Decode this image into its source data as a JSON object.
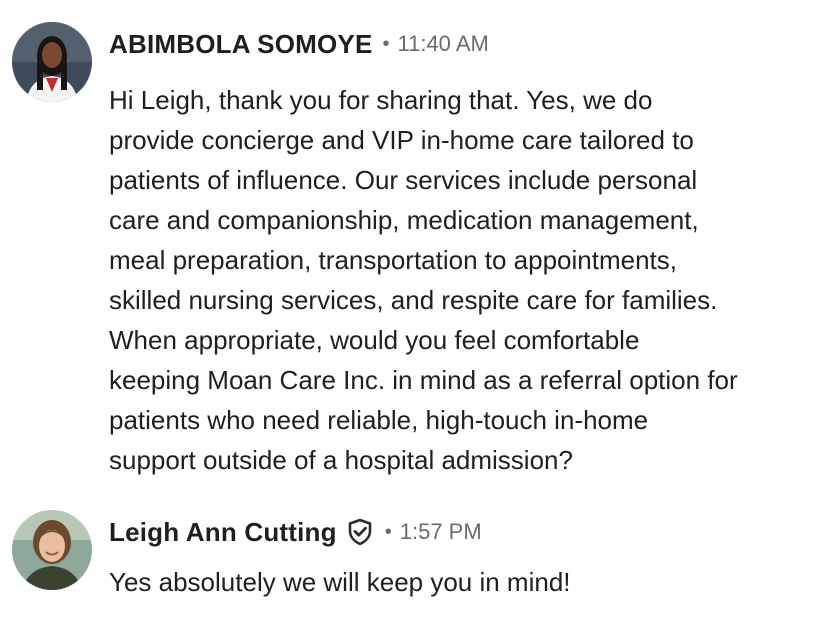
{
  "messages": [
    {
      "sender": "ABIMBOLA SOMOYE",
      "separator": "•",
      "time": "11:40 AM",
      "avatar_icon": "profile-photo",
      "verified": false,
      "text": "Hi Leigh, thank you for sharing that. Yes, we do\nprovide concierge and VIP in-home care tailored to\npatients of influence. Our services include personal\ncare and companionship, medication management,\nmeal preparation, transportation to appointments,\nskilled nursing services, and respite care for families.\nWhen appropriate, would you feel comfortable\nkeeping Moan Care Inc. in mind as a referral option for\npatients who need reliable, high-touch in-home\nsupport outside of a hospital admission?"
    },
    {
      "sender": "Leigh Ann Cutting",
      "separator": "•",
      "time": "1:57 PM",
      "avatar_icon": "profile-photo",
      "verified": true,
      "verified_icon": "shield-check-icon",
      "text": "Yes absolutely we will keep you in mind!"
    }
  ],
  "colors": {
    "text": "#1f1f1f",
    "meta": "#6b6b6b",
    "background": "#ffffff"
  }
}
